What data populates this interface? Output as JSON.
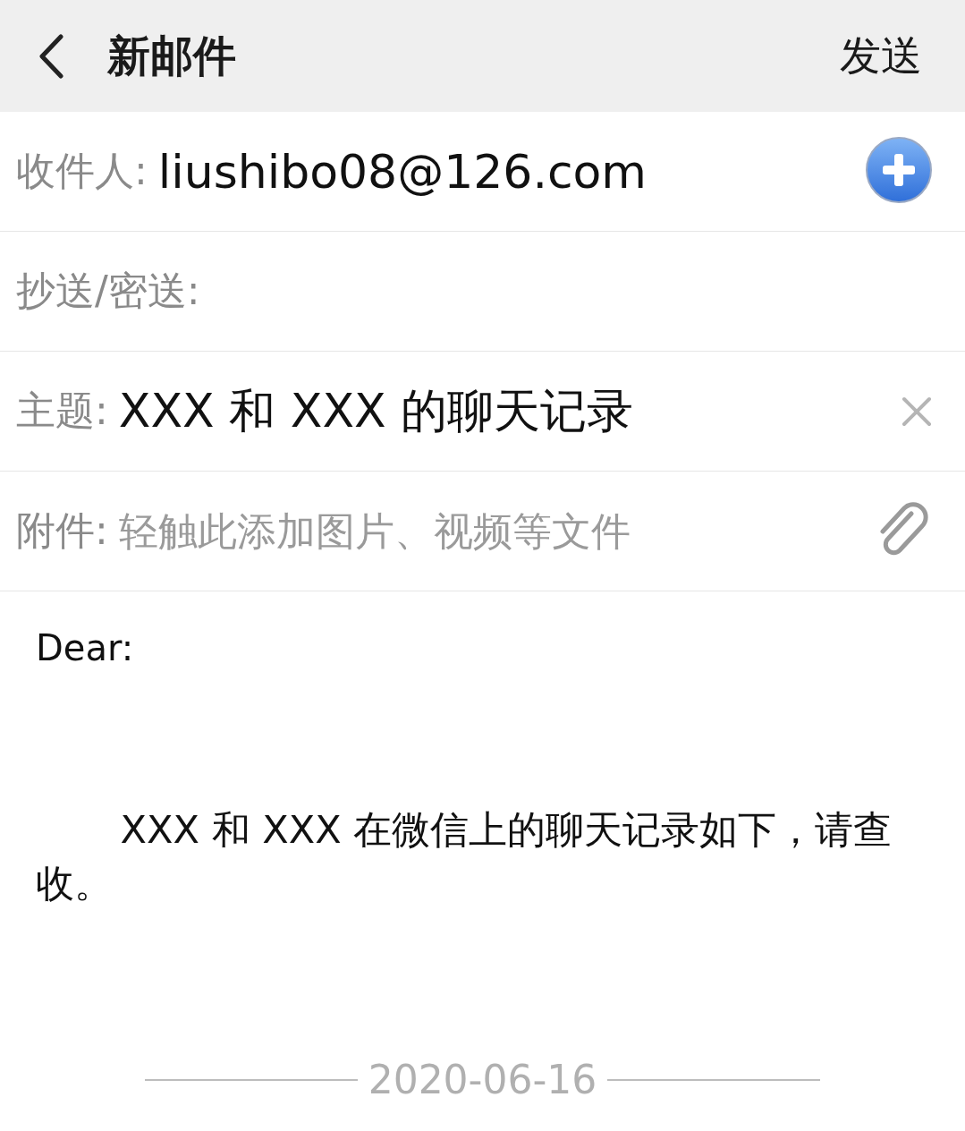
{
  "header": {
    "title": "新邮件",
    "send": "发送"
  },
  "fields": [
    {
      "kind": "recipient",
      "label": "收件人:",
      "value": "liushibo08@126.com"
    },
    {
      "kind": "cc",
      "label": "抄送/密送:"
    },
    {
      "kind": "subject",
      "label": "主题:",
      "value": "XXX 和 XXX 的聊天记录"
    },
    {
      "kind": "attachment",
      "label": "附件:",
      "placeholder": "轻触此添加图片、视频等文件"
    }
  ],
  "body": {
    "greeting": "Dear:",
    "paragraph": "XXX 和 XXX 在微信上的聊天记录如下，请查收。"
  },
  "date": "2020-06-16"
}
